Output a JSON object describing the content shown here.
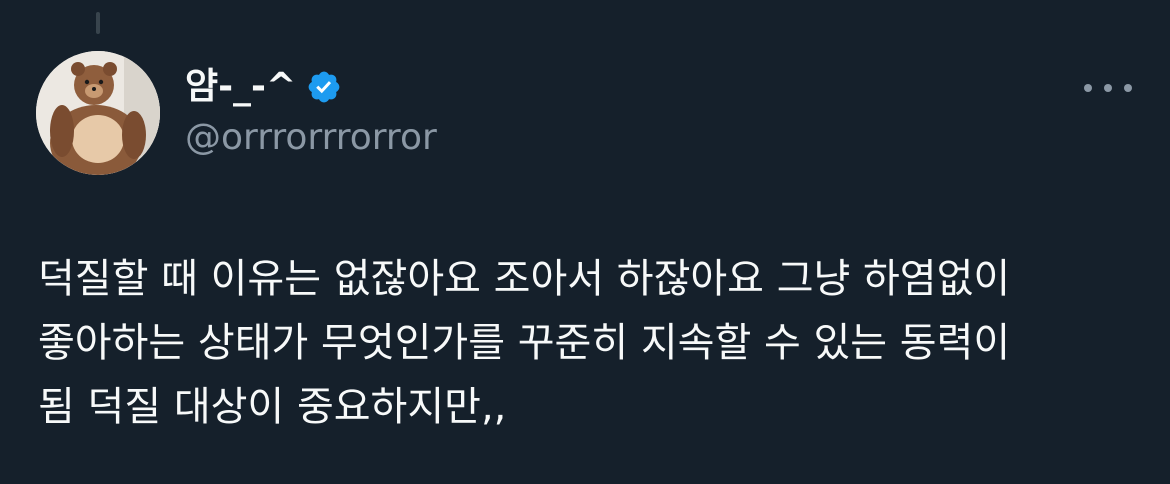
{
  "author": {
    "display_name": "얌-_-^",
    "verified": true,
    "handle": "@orrrorrrorror",
    "avatar_icon": "teddy-bear-avatar"
  },
  "tweet": {
    "lines": [
      "덕질할 때 이유는 없잖아요 조아서 하잖아요 그냥 하염없이",
      "좋아하는 상태가 무엇인가를 꾸준히 지속할 수 있는 동력이",
      "됨 덕질 대상이 중요하지만,,"
    ]
  },
  "icons": {
    "verified": "verified-badge-icon",
    "more": "more-options-icon"
  },
  "colors": {
    "background": "#15202b",
    "text_primary": "#f7f9f9",
    "text_secondary": "#8b98a5",
    "verified_blue": "#1d9bf0"
  }
}
